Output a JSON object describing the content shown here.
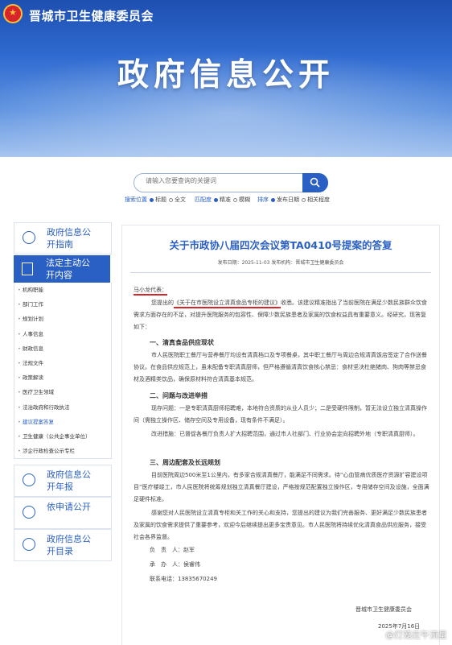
{
  "header": {
    "org_name": "晋城市卫生健康委员会",
    "banner": "政府信息公开"
  },
  "search": {
    "placeholder": "请输入您要查询的关键词"
  },
  "search_options": {
    "position_label": "搜索位置",
    "position_opts": [
      "标题",
      "全文"
    ],
    "match_label": "匹配度",
    "match_opts": [
      "精准",
      "模糊"
    ],
    "sort_label": "排序",
    "sort_opts": [
      "发布日期",
      "相关程度"
    ]
  },
  "sidebar": {
    "guide": "政府信息公开指南",
    "active": "法定主动公开内容",
    "items": [
      "机构职能",
      "部门工作",
      "规划计划",
      "人事信息",
      "财政信息",
      "法规文件",
      "政策解读",
      "医疗卫生领域",
      "法治政府和行政执法",
      "建议提案答复",
      "卫生健康（公共企事业单位）",
      "涉企行政检查公示专栏"
    ],
    "current_index": 9,
    "annual_report": "政府信息公开年报",
    "apply": "依申请公开",
    "catalog": "政府信息公开目录"
  },
  "article": {
    "title": "关于市政协八届四次会议第TA0410号提案的答复",
    "meta": "发布日期：2025-11-03 发布机构：晋城市卫生健康委员会",
    "salutation": "马小龙代表：",
    "intro_prefix": "您提出的",
    "intro_proposal": "《关于在市医院设立清真食品专柜的建议》",
    "intro_rest": "收悉。该建议精准指出了当前医院在满足少数民族群众饮食需求方面存在的不足，对提升医院服务的包容性、保障少数民族患者及家属的饮食权益具有重要意义。经研究，现答复如下：",
    "s1": "一、清真食品供应现状",
    "p1": "市人民医院职工餐厅与营养餐厅均设有清真档口及专项餐桌，其中职工餐厅与周边合规清真饭店签定了合作送餐协议。在食品供应规范上，虽未配备专职清真厨师，但严格遵循清真饮食核心禁忌：食材坚决杜绝猪肉、狗肉等禁忌食材及酒精类饮品，确保原材料符合清真基本规范。",
    "s2": "二、问题与改进举措",
    "p2": "现存问题：一是专职清真厨师招聘难，本地符合资质的从业人员少；二是受硬件限制，暂无法设立独立清真操作间（需独立操作区、储存空间及专用设备，现有条件不满足）。",
    "p3": "改进措施：已督促各餐厅负责人扩大招聘范围，通过市人社部门、行业协会定向招聘外地（专职清真厨师）。",
    "s3": "三、周边配套及长远规划",
    "p4": "目前医院周边500米至1公里内，有多家合规清真餐厅，能满足不同需求。待“心血管病优质医疗资源扩容建设项目”医疗楼竣工，市人民医院将统筹规划独立清真餐厅建设，严格按规范配置独立操作区，专用储存空间及设施，全面满足硬件标准。",
    "p5": "感谢您对人民医院设立清真专柜和关工作的关心和支持，您提出的建议为我们完善服务、更好满足少数民族患者及家属的饮食需求提供了重要参考，欢迎今后继续提出更多宝贵意见。市人民医院将持续优化清真食品供应服务，接受社会各界监督。",
    "lead": "负　责　人：赵军",
    "handler": "承　办　人：侯睿伟",
    "phone": "联系电话：13835670249",
    "sign_org": "晋城市卫生健康委员会",
    "sign_date": "2025年7月16日"
  },
  "watermark": "@灯笼庄午流星"
}
